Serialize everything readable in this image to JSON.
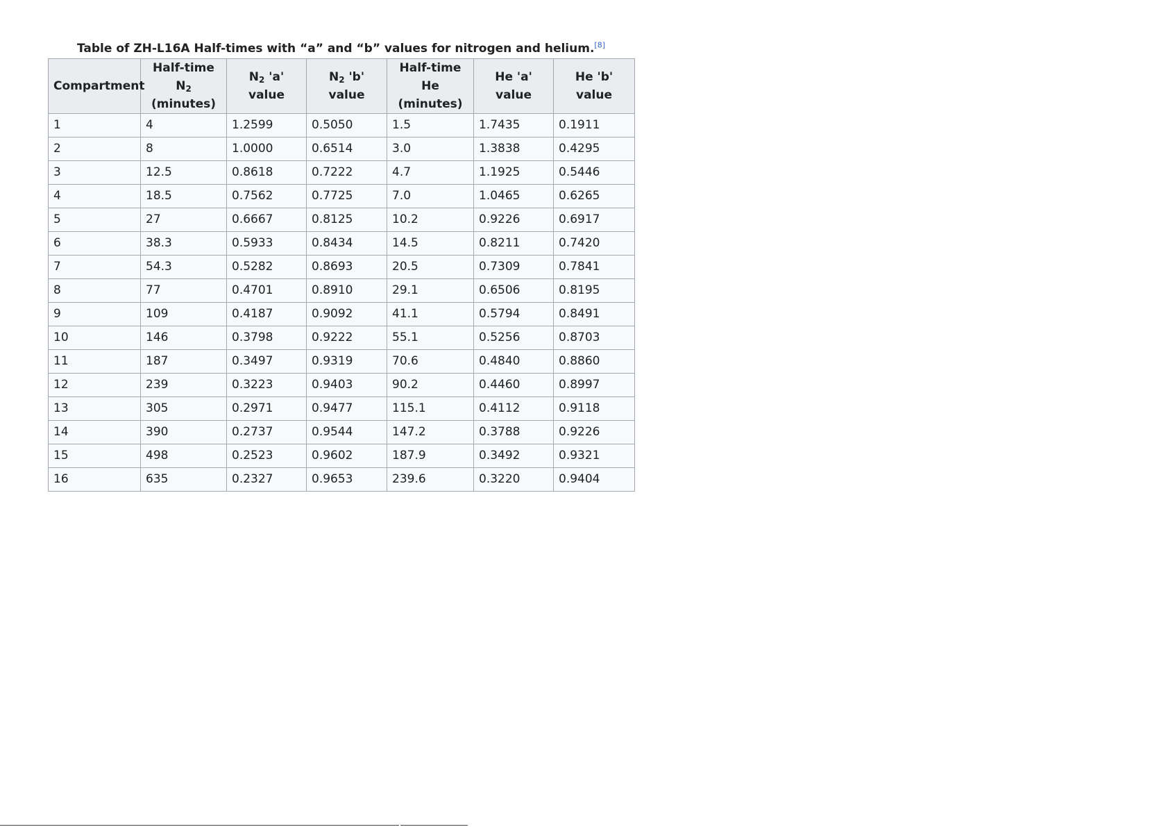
{
  "caption": {
    "text": "Table of ZH-L16A Half-times with “a” and “b” values for nitrogen and helium.",
    "ref": "[8]"
  },
  "headers": {
    "compartment": "Compartment",
    "n2_halftime_prefix": "Half-time N",
    "n2_halftime_sub": "2",
    "n2_halftime_unit": "(minutes)",
    "n2_a_prefix": "N",
    "n2_a_sub": "2",
    "n2_a_suffix": " 'a' value",
    "n2_b_prefix": "N",
    "n2_b_sub": "2",
    "n2_b_suffix": " 'b' value",
    "he_halftime": "Half-time He",
    "he_halftime_unit": "(minutes)",
    "he_a": "He 'a' value",
    "he_b": "He 'b' value"
  },
  "rows": [
    [
      "1",
      "4",
      "1.2599",
      "0.5050",
      "1.5",
      "1.7435",
      "0.1911"
    ],
    [
      "2",
      "8",
      "1.0000",
      "0.6514",
      "3.0",
      "1.3838",
      "0.4295"
    ],
    [
      "3",
      "12.5",
      "0.8618",
      "0.7222",
      "4.7",
      "1.1925",
      "0.5446"
    ],
    [
      "4",
      "18.5",
      "0.7562",
      "0.7725",
      "7.0",
      "1.0465",
      "0.6265"
    ],
    [
      "5",
      "27",
      "0.6667",
      "0.8125",
      "10.2",
      "0.9226",
      "0.6917"
    ],
    [
      "6",
      "38.3",
      "0.5933",
      "0.8434",
      "14.5",
      "0.8211",
      "0.7420"
    ],
    [
      "7",
      "54.3",
      "0.5282",
      "0.8693",
      "20.5",
      "0.7309",
      "0.7841"
    ],
    [
      "8",
      "77",
      "0.4701",
      "0.8910",
      "29.1",
      "0.6506",
      "0.8195"
    ],
    [
      "9",
      "109",
      "0.4187",
      "0.9092",
      "41.1",
      "0.5794",
      "0.8491"
    ],
    [
      "10",
      "146",
      "0.3798",
      "0.9222",
      "55.1",
      "0.5256",
      "0.8703"
    ],
    [
      "11",
      "187",
      "0.3497",
      "0.9319",
      "70.6",
      "0.4840",
      "0.8860"
    ],
    [
      "12",
      "239",
      "0.3223",
      "0.9403",
      "90.2",
      "0.4460",
      "0.8997"
    ],
    [
      "13",
      "305",
      "0.2971",
      "0.9477",
      "115.1",
      "0.4112",
      "0.9118"
    ],
    [
      "14",
      "390",
      "0.2737",
      "0.9544",
      "147.2",
      "0.3788",
      "0.9226"
    ],
    [
      "15",
      "498",
      "0.2523",
      "0.9602",
      "187.9",
      "0.3492",
      "0.9321"
    ],
    [
      "16",
      "635",
      "0.2327",
      "0.9653",
      "239.6",
      "0.3220",
      "0.9404"
    ]
  ]
}
